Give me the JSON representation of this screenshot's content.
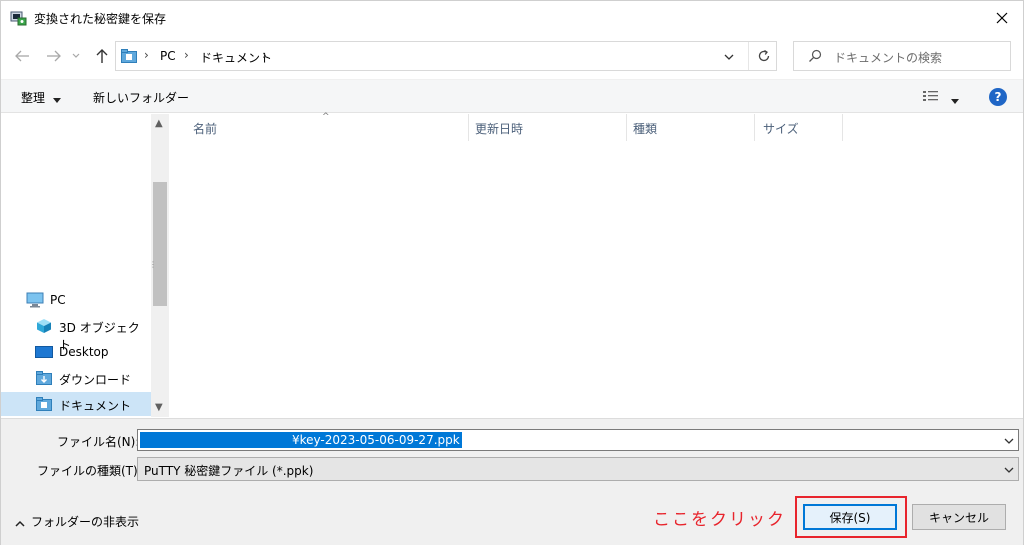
{
  "window": {
    "title": "変換された秘密鍵を保存"
  },
  "address": {
    "crumbs": [
      "PC",
      "ドキュメント"
    ]
  },
  "search": {
    "placeholder": "ドキュメントの検索"
  },
  "toolbar": {
    "organize_label": "整理",
    "new_folder_label": "新しいフォルダー",
    "help_label": "?"
  },
  "sidebar": {
    "items": [
      {
        "label": "PC",
        "icon": "pc-icon"
      },
      {
        "label": "3D オブジェクト",
        "icon": "3d-objects-icon"
      },
      {
        "label": "Desktop",
        "icon": "desktop-icon"
      },
      {
        "label": "ダウンロード",
        "icon": "downloads-icon"
      },
      {
        "label": "ドキュメント",
        "icon": "documents-icon",
        "selected": true
      }
    ]
  },
  "columns": [
    "名前",
    "更新日時",
    "種類",
    "サイズ"
  ],
  "form": {
    "filename_label": "ファイル名(N):",
    "filename_value": "¥key-2023-05-06-09-27.ppk",
    "filetype_label": "ファイルの種類(T):",
    "filetype_value": "PuTTY 秘密鍵ファイル (*.ppk)"
  },
  "footer": {
    "hide_folders_label": "フォルダーの非表示",
    "annotation": "ここをクリック",
    "save_label": "保存(S)",
    "cancel_label": "キャンセル"
  },
  "colors": {
    "accent": "#0078d7",
    "annotation": "#e8242c",
    "help": "#1f66c6",
    "selection": "#cce4f7"
  }
}
